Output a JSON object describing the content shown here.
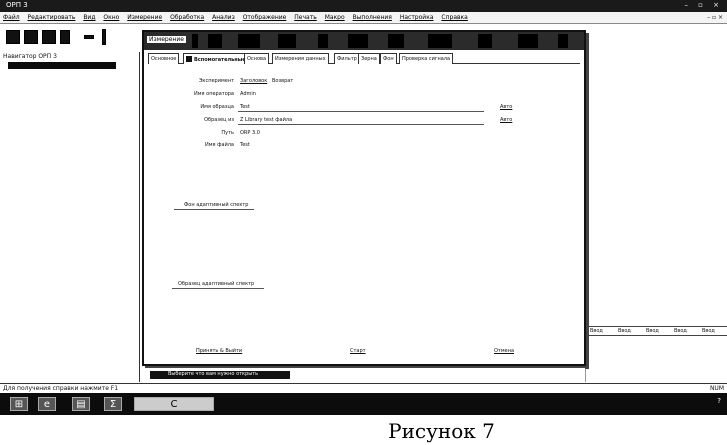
{
  "window": {
    "title": "ОРП 3",
    "controls": "– ▫ ×"
  },
  "menubar": {
    "items": [
      "Файл",
      "Редактировать",
      "Вид",
      "Окно",
      "Измерение",
      "Обработка",
      "Анализ",
      "Отображение",
      "Печать",
      "Макро",
      "Выполнения",
      "Настройка",
      "Справка"
    ],
    "right": "– ▫ ×"
  },
  "navigator": {
    "title": "Навигатор ОРП 3",
    "selected_item": ""
  },
  "dialog": {
    "title": "Измерение",
    "tabs": [
      {
        "label": "Основное",
        "active": false,
        "checked": false
      },
      {
        "label": "Вспомогательные",
        "active": true,
        "checked": true
      },
      {
        "label": "Основа",
        "active": false,
        "checked": false
      },
      {
        "label": "Измерения данных",
        "active": false,
        "checked": false
      },
      {
        "label": "Фильтр",
        "active": false,
        "checked": false
      },
      {
        "label": "Зерна",
        "active": false,
        "checked": false
      },
      {
        "label": "Фон",
        "active": false,
        "checked": false
      },
      {
        "label": "Проверка сигнала",
        "active": false,
        "checked": false
      }
    ],
    "fields": [
      {
        "label": "Эксперимент",
        "value": "Заголовок",
        "value2": "Возврат"
      },
      {
        "label": "Имя оператора",
        "value": "Admin",
        "value2": ""
      },
      {
        "label": "Имя образца",
        "value": "Test",
        "value2": ""
      },
      {
        "label": "Образец из",
        "value": "Z Library test файла",
        "value2": ""
      },
      {
        "label": "Путь",
        "value": "ORP 3.0",
        "value2": ""
      },
      {
        "label": "Имя файла",
        "value": "Test",
        "value2": ""
      }
    ],
    "side_buttons": [
      "Авто",
      "Авто"
    ],
    "section_bg_label": "Фон адаптивный спектр",
    "section_sample_label": "Образец адаптивный спектр",
    "footer": {
      "apply_close": "Принять & Выйти",
      "start": "Старт",
      "cancel": "Отмена"
    }
  },
  "right_columns": [
    "Ввод",
    "Ввод",
    "Ввод",
    "Ввод",
    "Ввод"
  ],
  "bottom_strip": {
    "task": "Выберите что вам нужно открыть"
  },
  "status": {
    "left": "Для получения справки нажмите F1",
    "right": "NUM"
  },
  "taskbar": {
    "clock": "",
    "date": ""
  },
  "caption": "Рисунок 7"
}
